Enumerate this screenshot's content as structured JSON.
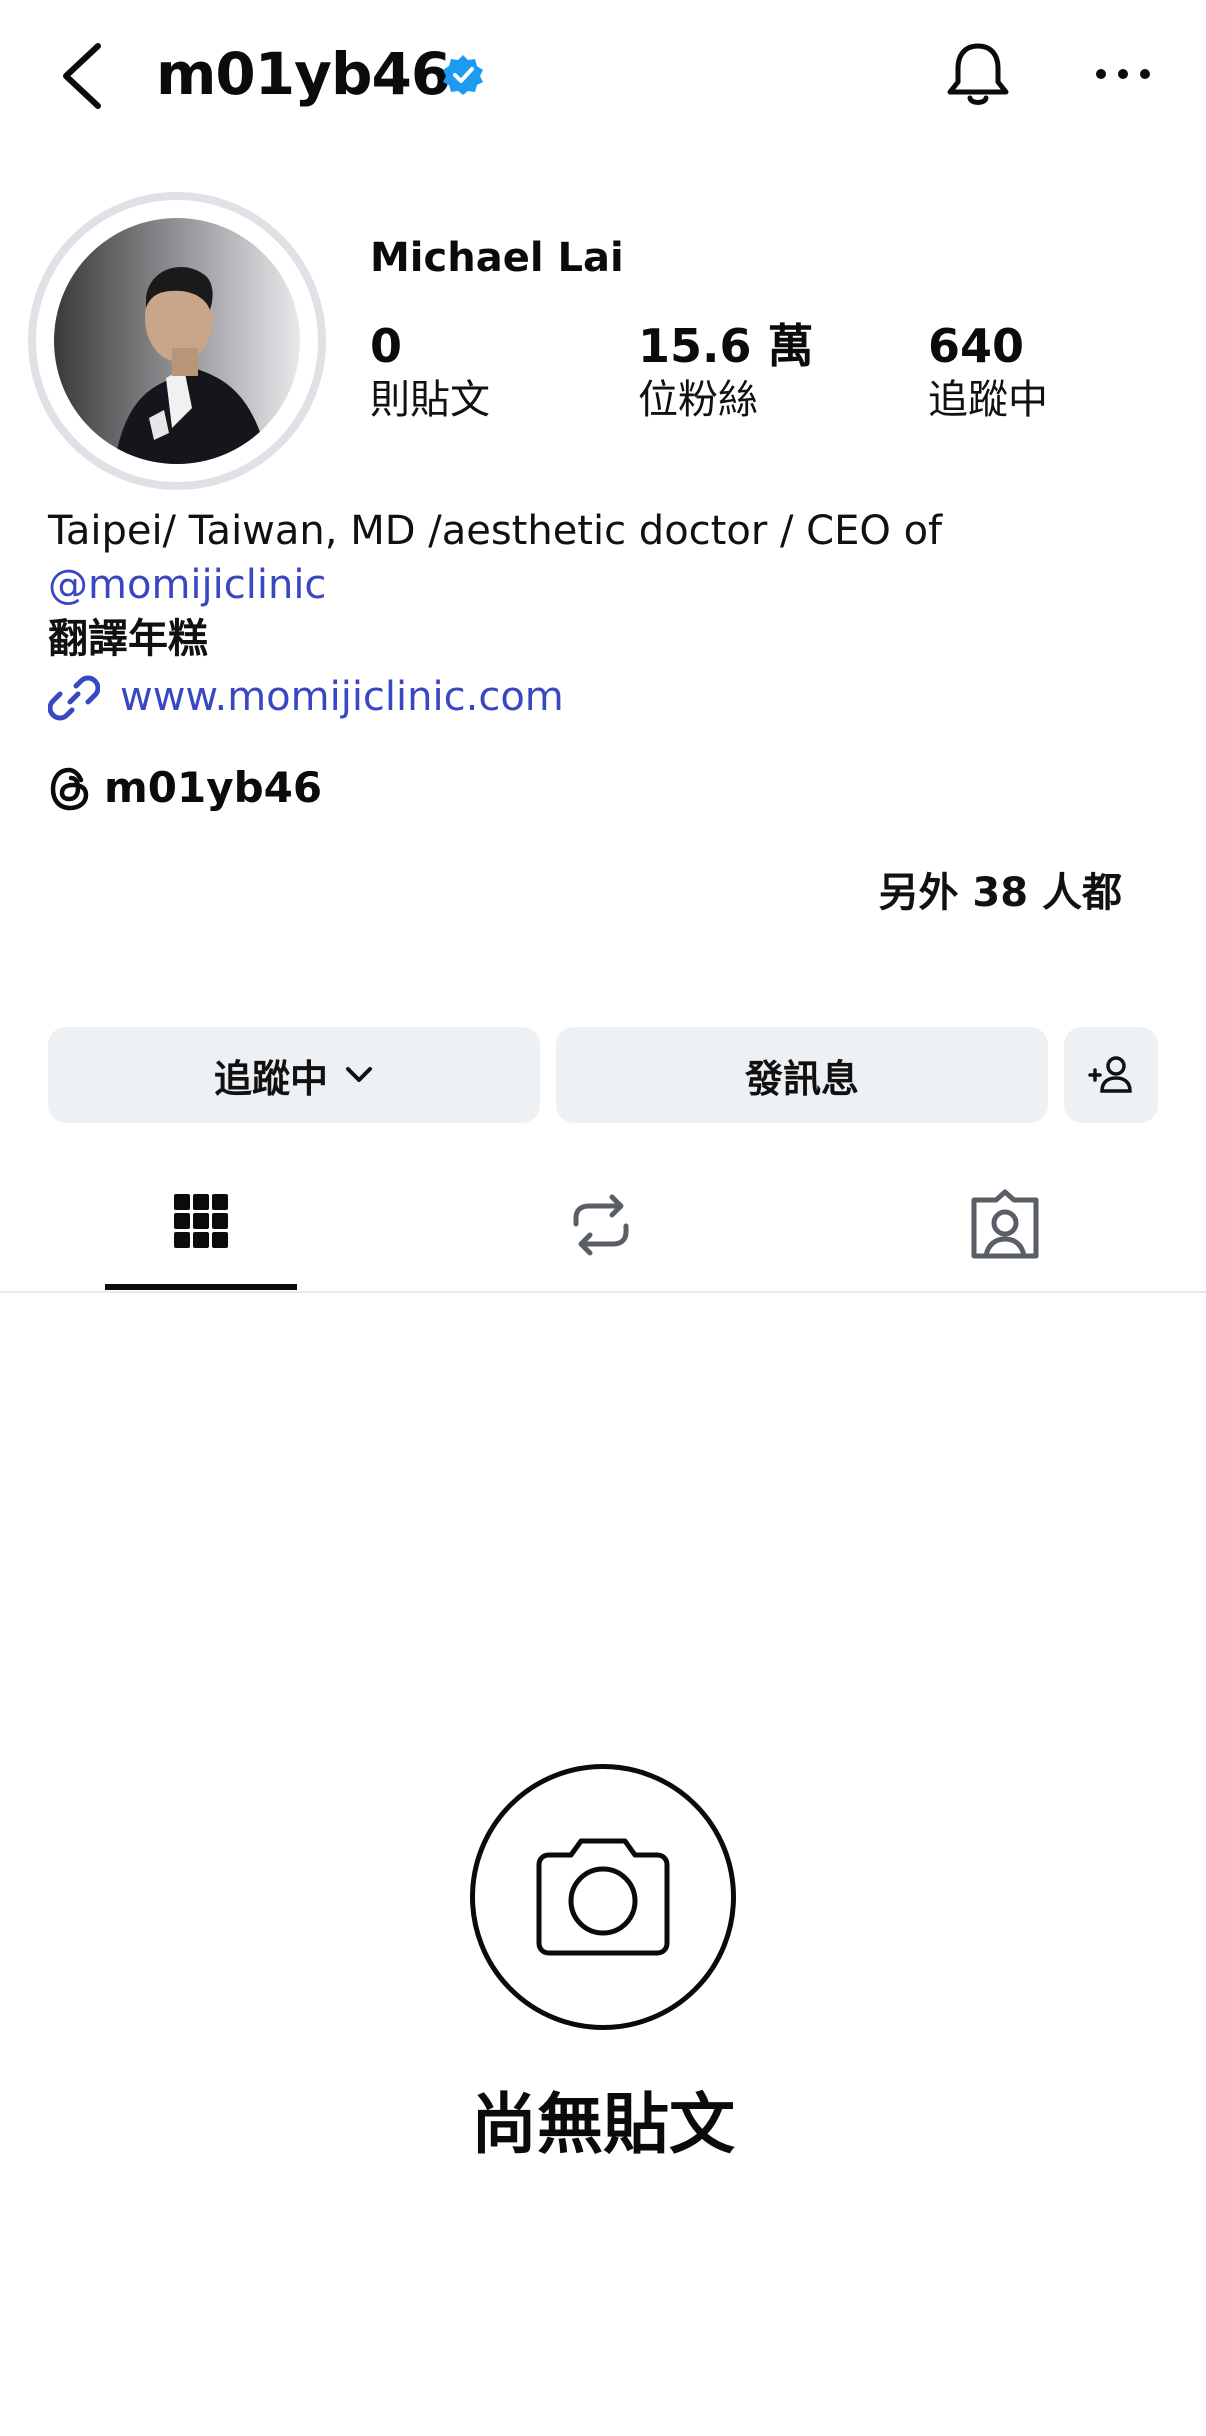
{
  "header": {
    "username": "m01yb46",
    "verified": true,
    "icons": {
      "back": "chevron-left-icon",
      "notifications": "bell-icon",
      "more": "more-horizontal-icon"
    }
  },
  "profile": {
    "full_name": "Michael Lai",
    "stats": [
      {
        "value": "0",
        "label": "則貼文"
      },
      {
        "value": "15.6 萬",
        "label": "位粉絲"
      },
      {
        "value": "640",
        "label": "追蹤中"
      }
    ],
    "bio_line1": "Taipei/ Taiwan, MD /aesthetic doctor / CEO of",
    "bio_mention": "@momijiclinic",
    "bio_line3": "翻譯年糕",
    "website": "www.momijiclinic.com",
    "threads_handle": "m01yb46",
    "mutual_followers": "另外 38 人都"
  },
  "actions": {
    "following_label": "追蹤中",
    "message_label": "發訊息",
    "add_friend_icon": "add-person-icon"
  },
  "tabs": [
    {
      "name": "posts",
      "icon": "grid-icon",
      "active": true
    },
    {
      "name": "reposts",
      "icon": "repost-icon",
      "active": false
    },
    {
      "name": "tagged",
      "icon": "tagged-person-icon",
      "active": false
    }
  ],
  "empty_state": {
    "icon": "camera-icon",
    "text": "尚無貼文"
  },
  "colors": {
    "link": "#3a47c2",
    "verified": "#1d9bf0",
    "button_bg": "#eef1f4",
    "text": "#0b0b0b"
  }
}
